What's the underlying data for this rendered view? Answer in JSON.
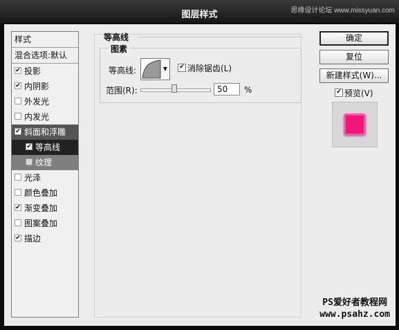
{
  "window": {
    "title": "图层样式",
    "watermark_top": "思缘设计论坛 www.missyuan.com"
  },
  "style_list": {
    "header": "样式",
    "blend_options": "混合选项:默认",
    "items": [
      {
        "label": "投影",
        "checked": true
      },
      {
        "label": "内阴影",
        "checked": true
      },
      {
        "label": "外发光",
        "checked": false
      },
      {
        "label": "内发光",
        "checked": false
      },
      {
        "label": "斜面和浮雕",
        "checked": true
      },
      {
        "label": "等高线",
        "checked": true
      },
      {
        "label": "纹理",
        "checked": false
      },
      {
        "label": "光泽",
        "checked": false
      },
      {
        "label": "颜色叠加",
        "checked": false
      },
      {
        "label": "渐变叠加",
        "checked": true
      },
      {
        "label": "图案叠加",
        "checked": false
      },
      {
        "label": "描边",
        "checked": true
      }
    ]
  },
  "contour_panel": {
    "section_title": "等高线",
    "group_title": "图素",
    "contour_label": "等高线:",
    "antialias_label": "消除锯齿(L)",
    "antialias_checked": true,
    "range_label": "范围(R):",
    "range_value": "50",
    "range_unit": "%",
    "range_slider_fraction": 0.5
  },
  "buttons": {
    "ok": "确定",
    "reset": "复位",
    "new_style": "新建样式(W)...",
    "preview_label": "预览(V)",
    "preview_checked": true
  },
  "colors": {
    "preview_swatch": "#f0167a"
  },
  "watermark": {
    "line1": "PS爱好者教程网",
    "line2": "www.psahz.com"
  }
}
